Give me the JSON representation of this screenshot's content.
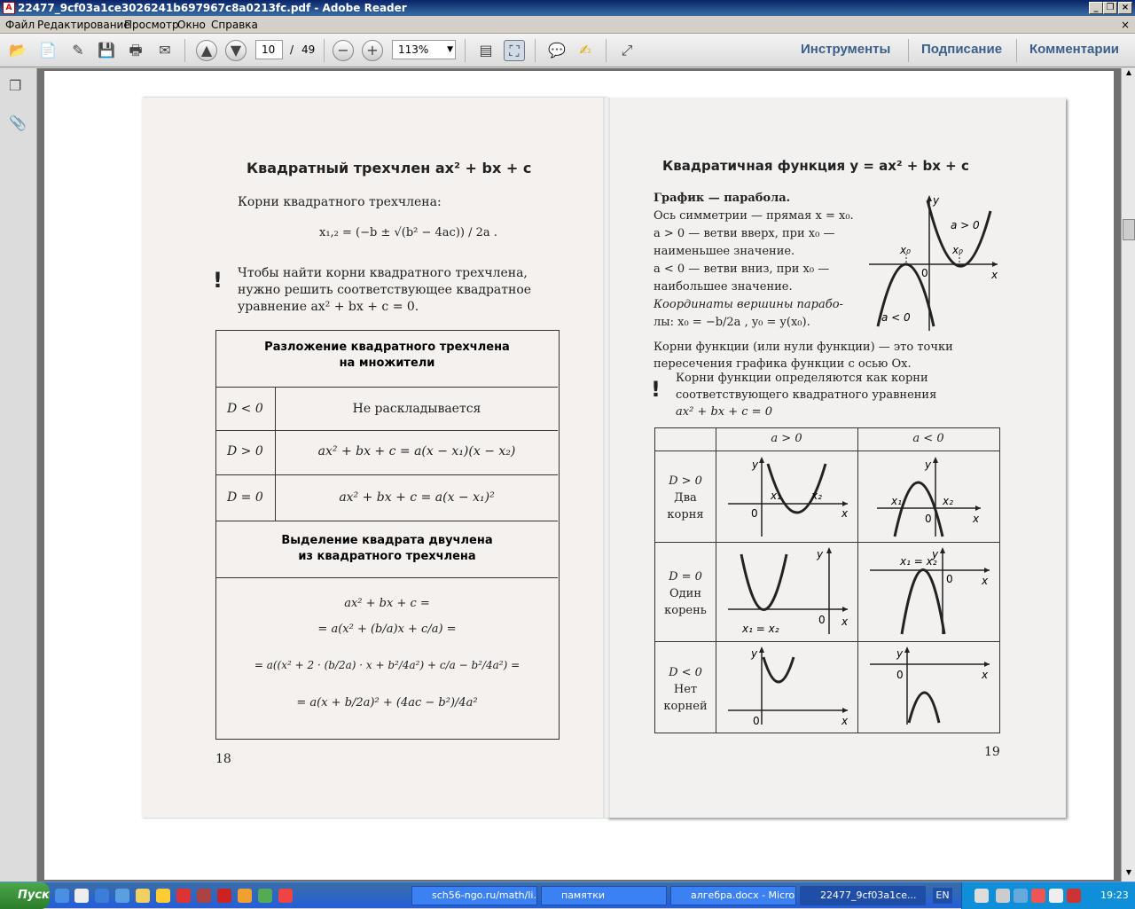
{
  "window": {
    "title": "22477_9cf03a1ce3026241b697967c8a0213fc.pdf - Adobe Reader"
  },
  "menu": [
    "Файл",
    "Редактирование",
    "Просмотр",
    "Окно",
    "Справка"
  ],
  "toolbar": {
    "page_current": "10",
    "page_sep": "/",
    "page_total": "49",
    "zoom": "113%"
  },
  "panels": {
    "tools": "Инструменты",
    "sign": "Подписание",
    "comment": "Комментарии"
  },
  "left": {
    "title": "Квадратный трехчлен ax² + bx + c",
    "roots_caption": "Корни квадратного трехчлена:",
    "roots_formula": "x₁,₂ = (−b ± √(b² − 4ac)) / 2a .",
    "note": [
      "Чтобы найти корни квадратного трехчлена,",
      "нужно решить соответствующее квадратное",
      "уравнение ax² + bx + c = 0."
    ],
    "table1_head": [
      "Разложение квадратного трехчлена",
      "на множители"
    ],
    "rows": [
      {
        "cond": "D < 0",
        "val": "Не раскладывается"
      },
      {
        "cond": "D > 0",
        "val": "ax² + bx + c = a(x − x₁)(x − x₂)"
      },
      {
        "cond": "D = 0",
        "val": "ax² + bx + c = a(x − x₁)²"
      }
    ],
    "table2_head": [
      "Выделение квадрата двучлена",
      "из квадратного трехчлена"
    ],
    "derivation": [
      "ax² + bx + c =",
      "= a(x² + (b/a)x + c/a) =",
      "= a((x² + 2 · (b/2a) · x + b²/4a²) + c/a − b²/4a²) =",
      "= a(x + b/2a)² + (4ac − b²)/4a²"
    ],
    "page_number": "18"
  },
  "right": {
    "title": "Квадратичная функция y = ax² + bx + c",
    "lines": [
      "График — парабола.",
      "Ось симметрии — прямая x = x₀.",
      "a > 0 — ветви вверх, при x₀ —",
      "наименьшее значение.",
      "a < 0 — ветви вниз, при x₀ —",
      "наибольшее значение.",
      "Координаты вершины парабо-",
      "лы: x₀ = −b/2a , y₀ = y(x₀)."
    ],
    "graph_labels": {
      "y": "y",
      "x": "x",
      "zero": "0",
      "x0": "x₀",
      "apos": "a > 0",
      "aneg": "a < 0"
    },
    "roots_def": [
      "Корни функции (или нули функции) — это точки",
      "пересечения графика функции с осью Ox."
    ],
    "note": [
      "Корни функции определяются как корни",
      "соответствующего квадратного уравнения",
      "ax² + bx + c = 0"
    ],
    "table_head": [
      "a > 0",
      "a < 0"
    ],
    "rows": [
      {
        "cond": [
          "D > 0",
          "Два",
          "корня"
        ],
        "l1": "x₁",
        "l2": "x₂"
      },
      {
        "cond": [
          "D = 0",
          "Один",
          "корень"
        ],
        "l1": "x₁ = x₂",
        "l2": "x₁ = x₂"
      },
      {
        "cond": [
          "D < 0",
          "Нет",
          "корней"
        ]
      }
    ],
    "page_number": "19"
  },
  "taskbar": {
    "start": "Пуск",
    "tasks": [
      "sch56-ngo.ru/math/li...",
      "памятки",
      "алгебра.docx - Micro...",
      "22477_9cf03a1ce..."
    ],
    "lang": "EN",
    "clock": "19:23"
  }
}
